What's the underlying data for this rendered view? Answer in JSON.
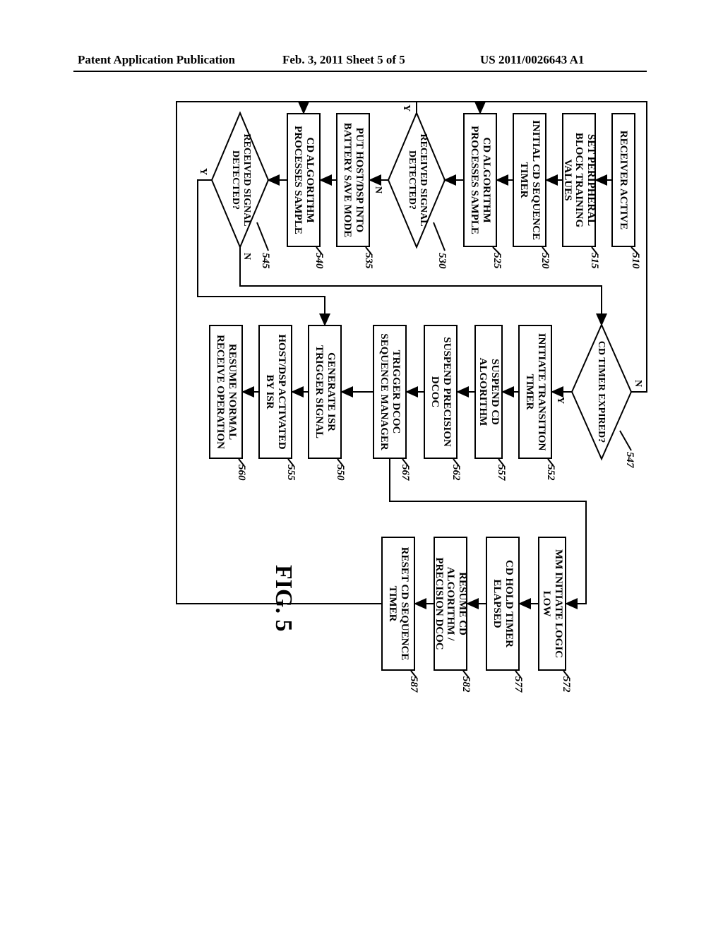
{
  "header": {
    "left": "Patent Application Publication",
    "mid": "Feb. 3, 2011  Sheet 5 of 5",
    "right": "US 2011/0026643 A1"
  },
  "figure_label": "FIG. 5",
  "nodes": {
    "n510": "RECEIVER ACTIVE",
    "n515": "SET PERIPHERAL BLOCK TRAINING VALUES",
    "n520": "INITIAL CD SEQUENCE TIMER",
    "n525": "CD ALGORITHM PROCESSES SAMPLE",
    "n530": "RECEIVED SIGNAL DETECTED?",
    "n535": "PUT HOST/DSP INTO BATTERY SAVE MODE",
    "n540": "CD ALGORITHM PROCESSES SAMPLE",
    "n545": "RECEIVED SIGNAL DETECTED?",
    "n547": "CD TIMER EXPIRED?",
    "n552": "INITIATE TRANSITION TIMER",
    "n557": "SUSPEND CD ALGORITHM",
    "n562": "SUSPEND PRECISION DCOC",
    "n567": "TRIGGER DCOC SEQUENCE MANAGER",
    "n550": "GENERATE ISR TRIGGER SIGNAL",
    "n555": "HOST/DSP ACTIVATED BY ISR",
    "n560": "RESUME NORMAL RECEIVE OPERATION",
    "n572": "MM INITIATE LOGIC LOW",
    "n577": "CD HOLD TIMER ELAPSED",
    "n582": "RESUME CD ALGORITHM / PRECISION DCOC",
    "n587": "RESET CD SEQUENCE TIMER"
  },
  "refs": {
    "r510": "510",
    "r515": "515",
    "r520": "520",
    "r525": "525",
    "r530": "530",
    "r535": "535",
    "r540": "540",
    "r545": "545",
    "r547": "547",
    "r550": "550",
    "r552": "552",
    "r555": "555",
    "r557": "557",
    "r560": "560",
    "r562": "562",
    "r567": "567",
    "r572": "572",
    "r577": "577",
    "r582": "582",
    "r587": "587"
  },
  "edge_labels": {
    "y": "Y",
    "n": "N"
  },
  "chart_data": {
    "type": "flowchart",
    "nodes": [
      {
        "id": "510",
        "type": "process",
        "label": "RECEIVER ACTIVE"
      },
      {
        "id": "515",
        "type": "process",
        "label": "SET PERIPHERAL BLOCK TRAINING VALUES"
      },
      {
        "id": "520",
        "type": "process",
        "label": "INITIAL CD SEQUENCE TIMER"
      },
      {
        "id": "525",
        "type": "process",
        "label": "CD ALGORITHM PROCESSES SAMPLE"
      },
      {
        "id": "530",
        "type": "decision",
        "label": "RECEIVED SIGNAL DETECTED?"
      },
      {
        "id": "535",
        "type": "process",
        "label": "PUT HOST/DSP INTO BATTERY SAVE MODE"
      },
      {
        "id": "540",
        "type": "process",
        "label": "CD ALGORITHM PROCESSES SAMPLE"
      },
      {
        "id": "545",
        "type": "decision",
        "label": "RECEIVED SIGNAL DETECTED?"
      },
      {
        "id": "547",
        "type": "decision",
        "label": "CD TIMER EXPIRED?"
      },
      {
        "id": "550",
        "type": "process",
        "label": "GENERATE ISR TRIGGER SIGNAL"
      },
      {
        "id": "552",
        "type": "process",
        "label": "INITIATE TRANSITION TIMER"
      },
      {
        "id": "555",
        "type": "process",
        "label": "HOST/DSP ACTIVATED BY ISR"
      },
      {
        "id": "557",
        "type": "process",
        "label": "SUSPEND CD ALGORITHM"
      },
      {
        "id": "560",
        "type": "process",
        "label": "RESUME NORMAL RECEIVE OPERATION"
      },
      {
        "id": "562",
        "type": "process",
        "label": "SUSPEND PRECISION DCOC"
      },
      {
        "id": "567",
        "type": "process",
        "label": "TRIGGER DCOC SEQUENCE MANAGER"
      },
      {
        "id": "572",
        "type": "process",
        "label": "MM INITIATE LOGIC LOW"
      },
      {
        "id": "577",
        "type": "process",
        "label": "CD HOLD TIMER ELAPSED"
      },
      {
        "id": "582",
        "type": "process",
        "label": "RESUME CD ALGORITHM / PRECISION DCOC"
      },
      {
        "id": "587",
        "type": "process",
        "label": "RESET CD SEQUENCE TIMER"
      }
    ],
    "edges": [
      {
        "from": "510",
        "to": "515"
      },
      {
        "from": "515",
        "to": "520"
      },
      {
        "from": "520",
        "to": "525"
      },
      {
        "from": "525",
        "to": "530"
      },
      {
        "from": "530",
        "to": "525",
        "label": "Y"
      },
      {
        "from": "530",
        "to": "535",
        "label": "N"
      },
      {
        "from": "535",
        "to": "540"
      },
      {
        "from": "540",
        "to": "545"
      },
      {
        "from": "545",
        "to": "550",
        "label": "Y"
      },
      {
        "from": "545",
        "to": "547",
        "label": "N"
      },
      {
        "from": "547",
        "to": "540",
        "label": "N"
      },
      {
        "from": "547",
        "to": "552",
        "label": "Y"
      },
      {
        "from": "550",
        "to": "555"
      },
      {
        "from": "552",
        "to": "557"
      },
      {
        "from": "555",
        "to": "560"
      },
      {
        "from": "557",
        "to": "562"
      },
      {
        "from": "562",
        "to": "567"
      },
      {
        "from": "567",
        "to": "572"
      },
      {
        "from": "567",
        "to": "550"
      },
      {
        "from": "572",
        "to": "577"
      },
      {
        "from": "577",
        "to": "582"
      },
      {
        "from": "582",
        "to": "587"
      },
      {
        "from": "587",
        "to": "540"
      }
    ]
  }
}
